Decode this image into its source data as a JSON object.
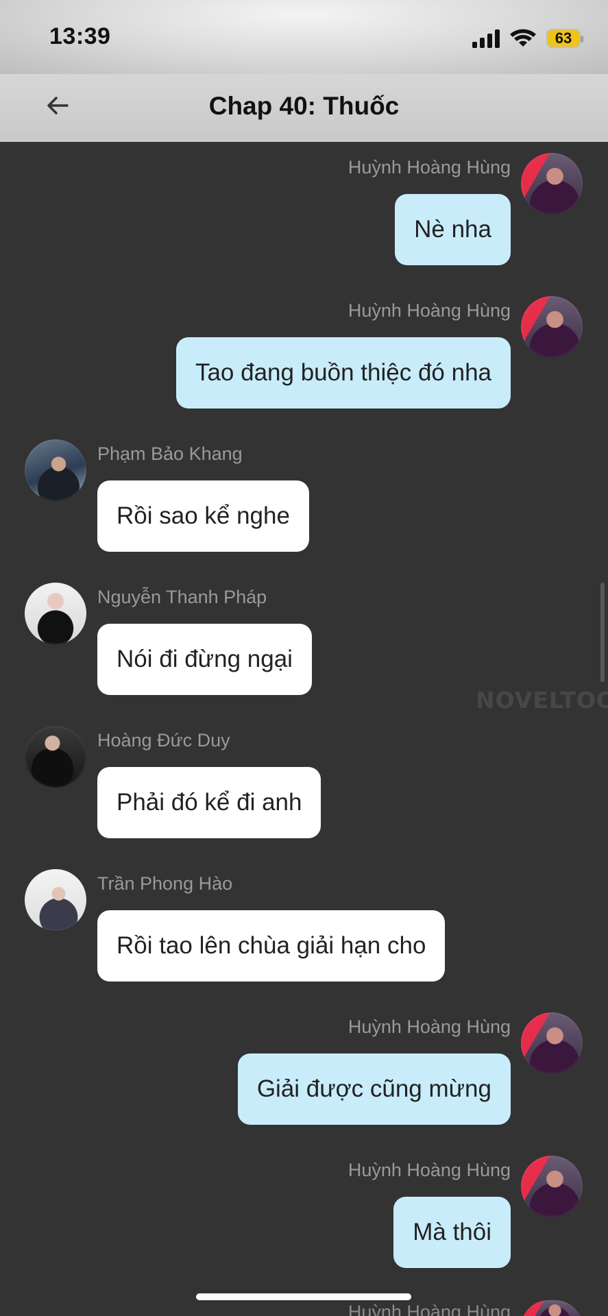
{
  "status_bar": {
    "time": "13:39",
    "battery": "63"
  },
  "header": {
    "title": "Chap 40: Thuốc"
  },
  "messages": [
    {
      "sender": "Huỳnh Hoàng Hùng",
      "text": "Nè nha",
      "side": "right",
      "avatar": "avatar-hung"
    },
    {
      "sender": "Huỳnh Hoàng Hùng",
      "text": "Tao đang buồn thiệc đó nha",
      "side": "right",
      "avatar": "avatar-hung"
    },
    {
      "sender": "Phạm Bảo Khang",
      "text": "Rồi sao kể nghe",
      "side": "left",
      "avatar": "avatar-khang"
    },
    {
      "sender": "Nguyễn Thanh Pháp",
      "text": "Nói đi đừng ngại",
      "side": "left",
      "avatar": "avatar-phap"
    },
    {
      "sender": "Hoàng Đức Duy",
      "text": "Phải đó kể đi anh",
      "side": "left",
      "avatar": "avatar-duy"
    },
    {
      "sender": "Trần Phong Hào",
      "text": "Rồi tao lên chùa giải hạn cho",
      "side": "left",
      "avatar": "avatar-hao"
    },
    {
      "sender": "Huỳnh Hoàng Hùng",
      "text": "Giải được cũng mừng",
      "side": "right",
      "avatar": "avatar-hung"
    },
    {
      "sender": "Huỳnh Hoàng Hùng",
      "text": "Mà thôi",
      "side": "right",
      "avatar": "avatar-hung"
    }
  ],
  "partial_message": {
    "sender": "Huỳnh Hoàng Hùng"
  },
  "watermark": "NOVELTOON",
  "icons": {
    "back": "back-arrow-icon",
    "signal": "cellular-signal-icon",
    "wifi": "wifi-icon",
    "battery": "battery-icon"
  }
}
